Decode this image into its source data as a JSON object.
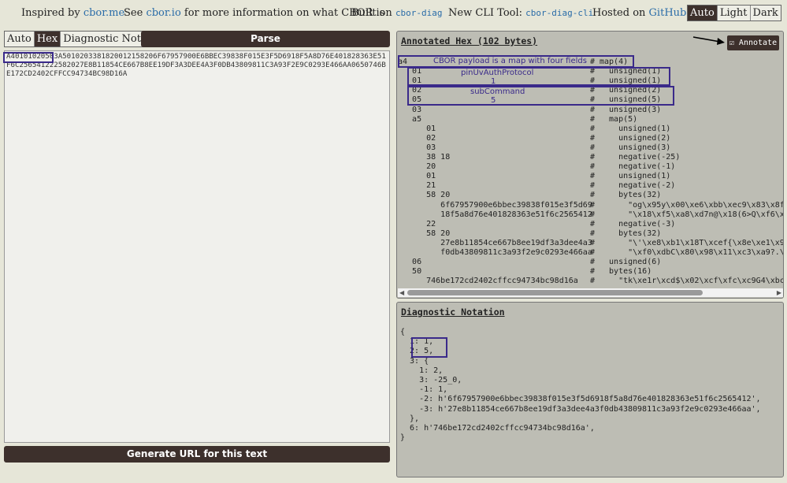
{
  "topbar": {
    "inspired_prefix": "Inspired by",
    "inspired_link": "cbor.me",
    "see_prefix": "See",
    "see_link": "cbor.io",
    "see_suffix": "for more information on what CBOR is",
    "built_prefix": "Built on",
    "built_link": "cbor-diag",
    "cli_prefix": "New CLI Tool:",
    "cli_link": "cbor-diag-cli",
    "hosted_prefix": "Hosted on",
    "hosted_link": "GitHub",
    "theme_options": [
      "Auto",
      "Light",
      "Dark"
    ],
    "theme_selected": "Auto"
  },
  "input_modes": [
    "Auto",
    "Hex",
    "Diagnostic Notation"
  ],
  "input_mode_selected": "Hex",
  "parse_label": "Parse",
  "input_text": "A401010205 03A5010203381820012158206F67957900E6BBEC39838F015E3F5D6918F5A8D76E401828363E51F6C256541222582027E8B11854CE667B8EE19DF3A3DEE4A3F0DB43809811C3A93F2E9C0293E466AA0650746BE172CD2402CFFCC94734BC98D16A",
  "input_highlight": "A401010205",
  "input_rest": "03A5010203381820012158206F67957900E6BBEC39838F015E3F5D6918F5A8D76E401828363E51F6C256541222582027E8B11854CE667B8EE19DF3A3DEE4A3F0DB43809811C3A93F2E9C0293E466AA0650746BE172CD2402CFFCC94734BC98D16A",
  "generate_label": "Generate URL for this text",
  "annotated": {
    "title": "Annotated Hex (102 bytes)",
    "annotate_label": "☑ Annotate",
    "rows": [
      {
        "hex": "a4",
        "desc": "map(4)"
      },
      {
        "hex": "   01",
        "desc": "  unsigned(1)"
      },
      {
        "hex": "   01",
        "desc": "  unsigned(1)"
      },
      {
        "hex": "   02",
        "desc": "  unsigned(2)"
      },
      {
        "hex": "   05",
        "desc": "  unsigned(5)"
      },
      {
        "hex": "   03",
        "desc": "  unsigned(3)"
      },
      {
        "hex": "   a5",
        "desc": "  map(5)"
      },
      {
        "hex": "      01",
        "desc": "    unsigned(1)"
      },
      {
        "hex": "      02",
        "desc": "    unsigned(2)"
      },
      {
        "hex": "      03",
        "desc": "    unsigned(3)"
      },
      {
        "hex": "      38 18",
        "desc": "    negative(-25)"
      },
      {
        "hex": "      20",
        "desc": "    negative(-1)"
      },
      {
        "hex": "      01",
        "desc": "    unsigned(1)"
      },
      {
        "hex": "      21",
        "desc": "    negative(-2)"
      },
      {
        "hex": "      58 20",
        "desc": "    bytes(32)"
      },
      {
        "hex": "         6f67957900e6bbec39838f015e3f5d69",
        "desc": "      \"og\\x95y\\x00\\xe6\\xbb\\xec9\\x83\\x8f\\x"
      },
      {
        "hex": "         18f5a8d76e401828363e51f6c2565412",
        "desc": "      \"\\x18\\xf5\\xa8\\xd7n@\\x18(6>Q\\xf6\\xc2"
      },
      {
        "hex": "      22",
        "desc": "    negative(-3)"
      },
      {
        "hex": "      58 20",
        "desc": "    bytes(32)"
      },
      {
        "hex": "         27e8b11854ce667b8ee19df3a3dee4a3",
        "desc": "      \"\\'\\xe8\\xb1\\x18T\\xcef{\\x8e\\xe1\\x9d\\"
      },
      {
        "hex": "         f0db43809811c3a93f2e9c0293e466aa",
        "desc": "      \"\\xf0\\xdbC\\x80\\x98\\x11\\xc3\\xa9?.\\x9"
      },
      {
        "hex": "   06",
        "desc": "  unsigned(6)"
      },
      {
        "hex": "   50",
        "desc": "  bytes(16)"
      },
      {
        "hex": "      746be172cd2402cffcc94734bc98d16a",
        "desc": "    \"tk\\xe1r\\xcd$\\x02\\xcf\\xfc\\xc9G4\\xbc\\x"
      }
    ],
    "annotations": {
      "payload": "CBOR payload is a map with four fields",
      "pin_label": "pinUvAuthProtocol",
      "pin_value": "1",
      "sub_label": "subCommand",
      "sub_value": "5"
    }
  },
  "diagnostic": {
    "title": "Diagnostic Notation",
    "lines": [
      "{",
      "  1: 1,",
      "  2: 5,",
      "  3: {",
      "    1: 2,",
      "    3: -25_0,",
      "    -1: 1,",
      "    -2: h'6f67957900e6bbec39838f015e3f5d6918f5a8d76e401828363e51f6c2565412',",
      "    -3: h'27e8b11854ce667b8ee19df3a3dee4a3f0db43809811c3a93f2e9c0293e466aa',",
      "  },",
      "  6: h'746be172cd2402cffcc94734bc98d16a',",
      "}"
    ]
  },
  "colors": {
    "accent_dark": "#3d302c",
    "annotation": "#3a2a8a",
    "link": "#2a6ca8"
  }
}
